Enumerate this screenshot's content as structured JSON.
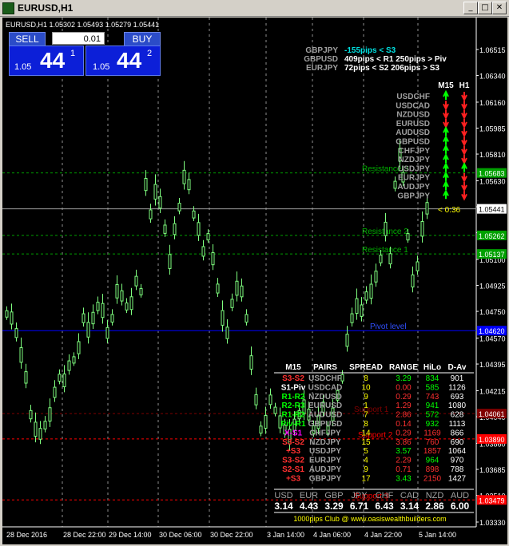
{
  "window": {
    "title": "EURUSD,H1",
    "min_label": "_",
    "max_label": "□",
    "close_label": "✕"
  },
  "chart_header": "EURUSD,H1  1.05302 1.05493 1.05279 1.05441",
  "trade_panel": {
    "sell_label": "SELL",
    "buy_label": "BUY",
    "lot_value": "0.01",
    "sell_prefix": "1.05",
    "sell_big": "44",
    "sell_sup": "1",
    "buy_prefix": "1.05",
    "buy_big": "44",
    "buy_sup": "2"
  },
  "pivot_info": [
    {
      "pair": "GBPJPY",
      "text": "-155pips < S3",
      "color": "#00e0e0"
    },
    {
      "pair": "GBPUSD",
      "text": "409pips < R1    250pips > Piv",
      "color": "#ffffff"
    },
    {
      "pair": "EURJPY",
      "text": "72pips < S2    206pips > S3",
      "color": "#ffffff"
    }
  ],
  "trend_matrix": {
    "headers": [
      "M15",
      "H1"
    ],
    "rows": [
      {
        "pair": "USDCHF",
        "m15": "up",
        "h1": "down"
      },
      {
        "pair": "USDCAD",
        "m15": "down",
        "h1": "down"
      },
      {
        "pair": "NZDUSD",
        "m15": "down",
        "h1": "down"
      },
      {
        "pair": "EURUSD",
        "m15": "down",
        "h1": "down"
      },
      {
        "pair": "AUDUSD",
        "m15": "up",
        "h1": "down"
      },
      {
        "pair": "GBPUSD",
        "m15": "up",
        "h1": "down"
      },
      {
        "pair": "CHFJPY",
        "m15": "up",
        "h1": "down"
      },
      {
        "pair": "NZDJPY",
        "m15": "up",
        "h1": "down"
      },
      {
        "pair": "USDJPY",
        "m15": "up",
        "h1": "up"
      },
      {
        "pair": "EURJPY",
        "m15": "up",
        "h1": "down"
      },
      {
        "pair": "AUDJPY",
        "m15": "up",
        "h1": "down"
      },
      {
        "pair": "GBPJPY",
        "m15": "up",
        "h1": "down"
      }
    ],
    "countdown": "< 0:36"
  },
  "price_axis": {
    "labels": [
      "1.06515",
      "1.06340",
      "1.06160",
      "1.05985",
      "1.05810",
      "1.05630",
      "1.05455",
      "1.05280",
      "1.05100",
      "1.04925",
      "1.04750",
      "1.04570",
      "1.04395",
      "1.04215",
      "1.04040",
      "1.03860",
      "1.03685",
      "1.03510",
      "1.03330"
    ],
    "markers": [
      {
        "label": "1.05683",
        "color": "#00a000"
      },
      {
        "label": "1.05441",
        "color": "#ffffff"
      },
      {
        "label": "1.05262",
        "color": "#00a000"
      },
      {
        "label": "1.05137",
        "color": "#00a000"
      },
      {
        "label": "1.04620",
        "color": "#0000ff"
      },
      {
        "label": "1.04061",
        "color": "#800000"
      },
      {
        "label": "1.03890",
        "color": "#ff0000"
      },
      {
        "label": "1.03479",
        "color": "#ff0000"
      }
    ]
  },
  "time_axis": [
    "28 Dec 2016",
    "28 Dec 22:00",
    "29 Dec 14:00",
    "30 Dec 06:00",
    "30 Dec 22:00",
    "3 Jan 14:00",
    "4 Jan 06:00",
    "4 Jan 22:00",
    "5 Jan 14:00"
  ],
  "line_labels": {
    "resistance1": "Resistance 1",
    "resistance2": "Resistance 2",
    "resistance3": "Resistance 3",
    "pivot": "Pivot level",
    "support1": "Support 1",
    "support2": "Support 2",
    "support3": "Support 3"
  },
  "pairs_table": {
    "headers": [
      "M15",
      "PAIRS",
      "SPREAD",
      "RANGE",
      "HiLo",
      "D-Av"
    ],
    "rows": [
      {
        "m15": "S3-S2",
        "m15_color": "#ff3030",
        "pair": "USDCHF",
        "spread": "8",
        "range": "3.29",
        "range_color": "#00ff00",
        "hilo": "834",
        "hilo_color": "#00ff00",
        "dav": "901"
      },
      {
        "m15": "S1-Piv",
        "m15_color": "#ffffff",
        "pair": "USDCAD",
        "spread": "10",
        "range": "0.00",
        "range_color": "#ff3030",
        "hilo": "585",
        "hilo_color": "#00ff00",
        "dav": "1126"
      },
      {
        "m15": "R1-R2",
        "m15_color": "#00ff00",
        "pair": "NZDUSD",
        "spread": "9",
        "range": "0.29",
        "range_color": "#ff3030",
        "hilo": "743",
        "hilo_color": "#ff3030",
        "dav": "693"
      },
      {
        "m15": "R2-R3",
        "m15_color": "#00ff00",
        "pair": "EURUSD",
        "spread": "1",
        "range": "1.29",
        "range_color": "#ff3030",
        "hilo": "941",
        "hilo_color": "#00ff00",
        "dav": "1080"
      },
      {
        "m15": "R1-R2",
        "m15_color": "#00ff00",
        "pair": "AUDUSD",
        "spread": "7",
        "range": "2.86",
        "range_color": "#ff3030",
        "hilo": "572",
        "hilo_color": "#00ff00",
        "dav": "628"
      },
      {
        "m15": "Piv-R1",
        "m15_color": "#00ff00",
        "pair": "GBPUSD",
        "spread": "8",
        "range": "0.14",
        "range_color": "#ff3030",
        "hilo": "932",
        "hilo_color": "#00ff00",
        "dav": "1113"
      },
      {
        "m15": "X-S1",
        "m15_color": "#ff00ff",
        "pair": "CHFJPY",
        "spread": "14",
        "range": "0.29",
        "range_color": "#ff3030",
        "hilo": "1169",
        "hilo_color": "#ff3030",
        "dav": "866"
      },
      {
        "m15": "S3-S2",
        "m15_color": "#ff3030",
        "pair": "NZDJPY",
        "spread": "15",
        "range": "3.86",
        "range_color": "#ff3030",
        "hilo": "760",
        "hilo_color": "#ff3030",
        "dav": "690"
      },
      {
        "m15": "+S3",
        "m15_color": "#ff3030",
        "pair": "USDJPY",
        "spread": "5",
        "range": "3.57",
        "range_color": "#00ff00",
        "hilo": "1857",
        "hilo_color": "#ff3030",
        "dav": "1064"
      },
      {
        "m15": "S3-S2",
        "m15_color": "#ff3030",
        "pair": "EURJPY",
        "spread": "4",
        "range": "2.29",
        "range_color": "#ff3030",
        "hilo": "964",
        "hilo_color": "#00ff00",
        "dav": "970"
      },
      {
        "m15": "S2-S1",
        "m15_color": "#ff3030",
        "pair": "AUDJPY",
        "spread": "9",
        "range": "0.71",
        "range_color": "#ff3030",
        "hilo": "898",
        "hilo_color": "#ff3030",
        "dav": "788"
      },
      {
        "m15": "+S3",
        "m15_color": "#ff3030",
        "pair": "GBPJPY",
        "spread": "17",
        "range": "3.43",
        "range_color": "#00ff00",
        "hilo": "2150",
        "hilo_color": "#ff3030",
        "dav": "1427"
      }
    ]
  },
  "currency_strength": {
    "headers": [
      "USD",
      "EUR",
      "GBP",
      "JPY",
      "CHF",
      "CAD",
      "NZD",
      "AUD"
    ],
    "values": [
      "3.14",
      "4.43",
      "3.29",
      "6.71",
      "6.43",
      "3.14",
      "2.86",
      "6.00"
    ]
  },
  "footer": "1000pips Club @ www.oasiswealthbuilders.com",
  "colors": {
    "bull": "#7fff7f",
    "bear": "#7fff7f",
    "axis": "#ffffff",
    "grid": "#ffffff"
  }
}
